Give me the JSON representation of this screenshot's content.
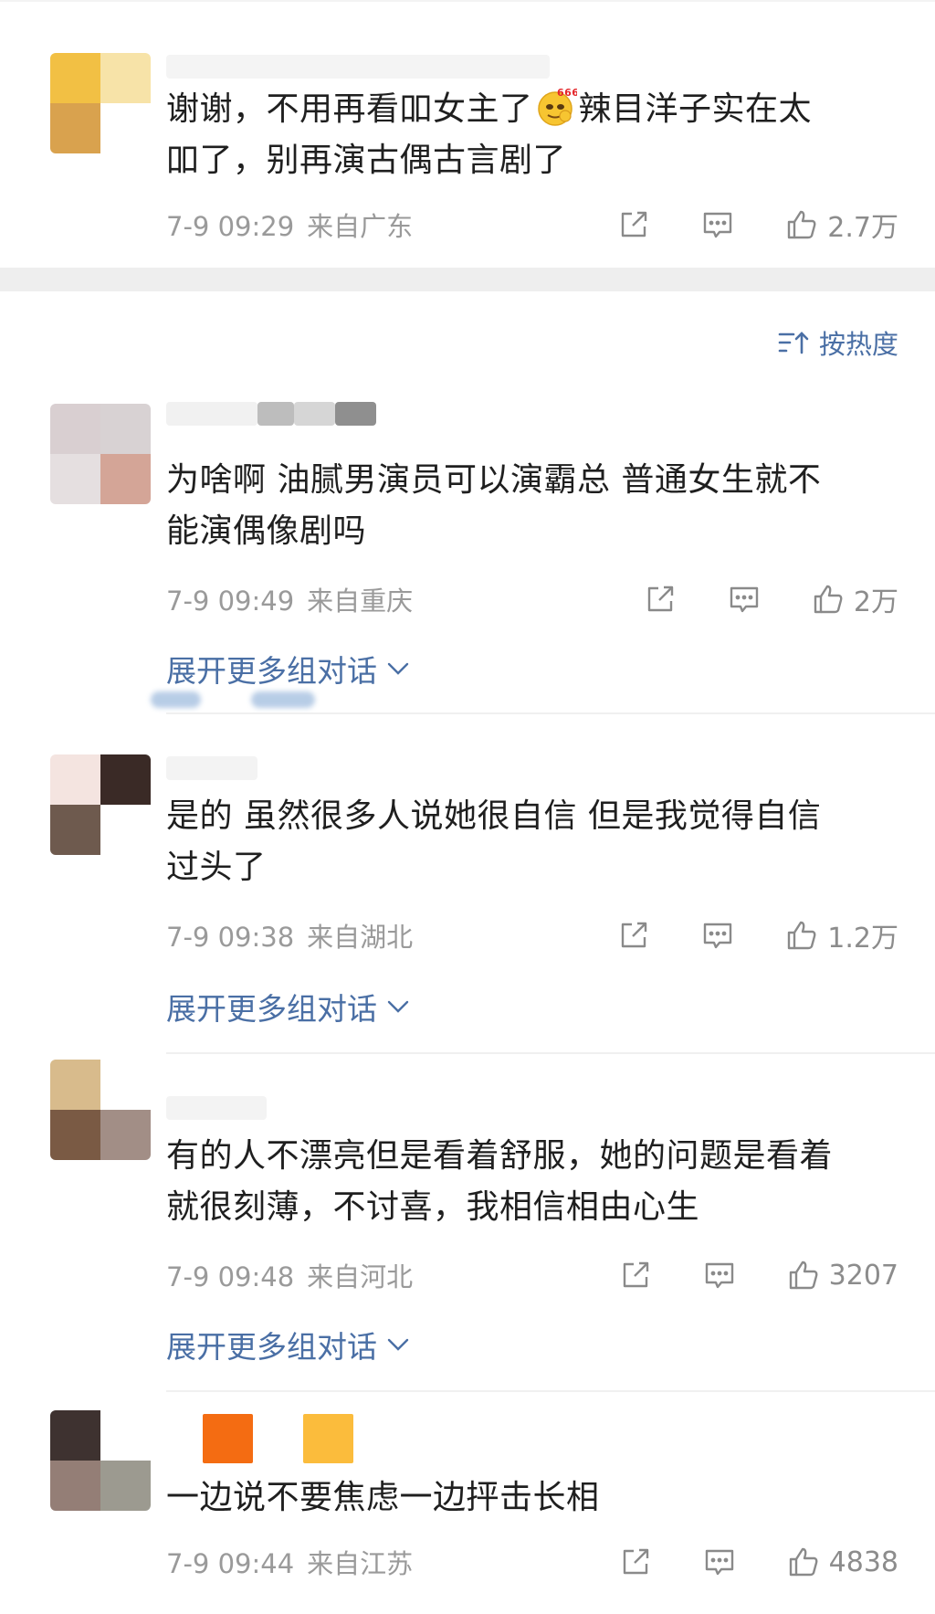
{
  "sort": {
    "label": "按热度",
    "icon": "sort-icon"
  },
  "expand_label": "展开更多组对话",
  "comments": [
    {
      "text_line1": "谢谢，不用再看吅女主了",
      "text_line1b": "辣目洋子实在太",
      "text_line2": "吅了，别再演古偶古言剧了",
      "emoji": "666-face-emoji",
      "time": "7-9 09:29",
      "location": "来自广东",
      "likes": "2.7万"
    },
    {
      "text_line1": "为啥啊 油腻男演员可以演霸总 普通女生就不",
      "text_line2": "能演偶像剧吗",
      "time": "7-9 09:49",
      "location": "来自重庆",
      "likes": "2万"
    },
    {
      "text_line1": "是的 虽然很多人说她很自信 但是我觉得自信",
      "text_line2": "过头了",
      "time": "7-9 09:38",
      "location": "来自湖北",
      "likes": "1.2万"
    },
    {
      "text_line1": "有的人不漂亮但是看着舒服，她的问题是看着",
      "text_line2": "就很刻薄，不讨喜，我相信相由心生",
      "time": "7-9 09:48",
      "location": "来自河北",
      "likes": "3207"
    },
    {
      "text_line1": "一边说不要焦虑一边抨击长相",
      "time": "7-9 09:44",
      "location": "来自江苏",
      "likes": "4838"
    }
  ],
  "colors": {
    "link": "#4a6fa5",
    "meta": "#9a9a9a",
    "text": "#1f1f1f",
    "separator": "#eeeeee"
  }
}
